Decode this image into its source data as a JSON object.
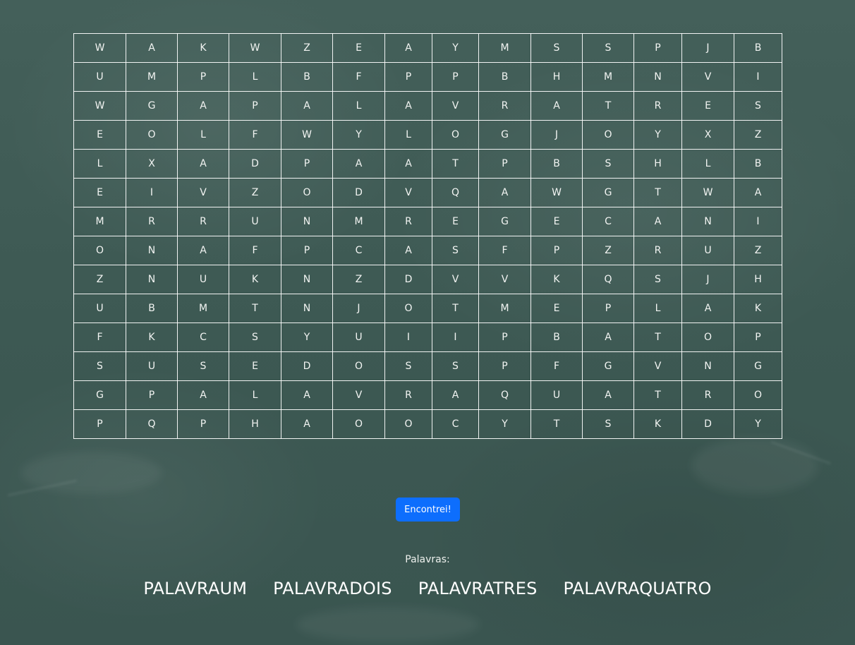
{
  "grid": [
    [
      "W",
      "A",
      "K",
      "W",
      "Z",
      "E",
      "A",
      "Y",
      "M",
      "S",
      "S",
      "P",
      "J",
      "B"
    ],
    [
      "U",
      "M",
      "P",
      "L",
      "B",
      "F",
      "P",
      "P",
      "B",
      "H",
      "M",
      "N",
      "V",
      "I"
    ],
    [
      "W",
      "G",
      "A",
      "P",
      "A",
      "L",
      "A",
      "V",
      "R",
      "A",
      "T",
      "R",
      "E",
      "S"
    ],
    [
      "E",
      "O",
      "L",
      "F",
      "W",
      "Y",
      "L",
      "O",
      "G",
      "J",
      "O",
      "Y",
      "X",
      "Z"
    ],
    [
      "L",
      "X",
      "A",
      "D",
      "P",
      "A",
      "A",
      "T",
      "P",
      "B",
      "S",
      "H",
      "L",
      "B"
    ],
    [
      "E",
      "I",
      "V",
      "Z",
      "O",
      "D",
      "V",
      "Q",
      "A",
      "W",
      "G",
      "T",
      "W",
      "A"
    ],
    [
      "M",
      "R",
      "R",
      "U",
      "N",
      "M",
      "R",
      "E",
      "G",
      "E",
      "C",
      "A",
      "N",
      "I"
    ],
    [
      "O",
      "N",
      "A",
      "F",
      "P",
      "C",
      "A",
      "S",
      "F",
      "P",
      "Z",
      "R",
      "U",
      "Z"
    ],
    [
      "Z",
      "N",
      "U",
      "K",
      "N",
      "Z",
      "D",
      "V",
      "V",
      "K",
      "Q",
      "S",
      "J",
      "H"
    ],
    [
      "U",
      "B",
      "M",
      "T",
      "N",
      "J",
      "O",
      "T",
      "M",
      "E",
      "P",
      "L",
      "A",
      "K"
    ],
    [
      "F",
      "K",
      "C",
      "S",
      "Y",
      "U",
      "I",
      "I",
      "P",
      "B",
      "A",
      "T",
      "O",
      "P"
    ],
    [
      "S",
      "U",
      "S",
      "E",
      "D",
      "O",
      "S",
      "S",
      "P",
      "F",
      "G",
      "V",
      "N",
      "G"
    ],
    [
      "G",
      "P",
      "A",
      "L",
      "A",
      "V",
      "R",
      "A",
      "Q",
      "U",
      "A",
      "T",
      "R",
      "O"
    ],
    [
      "P",
      "Q",
      "P",
      "H",
      "A",
      "O",
      "O",
      "C",
      "Y",
      "T",
      "S",
      "K",
      "D",
      "Y"
    ]
  ],
  "button": {
    "label": "Encontrei!"
  },
  "words_label": "Palavras:",
  "words": [
    "PALAVRAUM",
    "PALAVRADOIS",
    "PALAVRATRES",
    "PALAVRAQUATRO"
  ],
  "colors": {
    "background": "#3f5b55",
    "button": "#0d6efd",
    "text": "#ffffff"
  }
}
